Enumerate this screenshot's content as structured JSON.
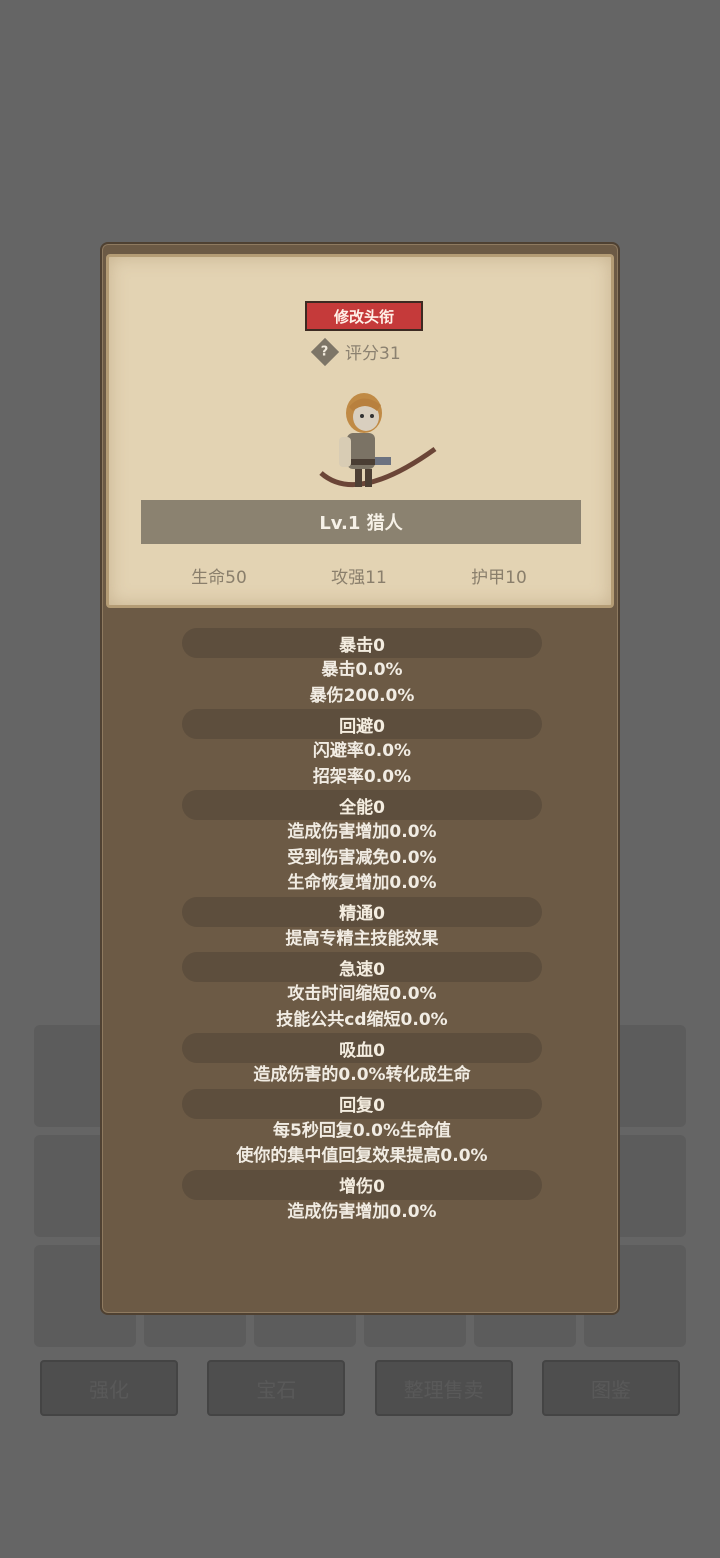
{
  "modal": {
    "title_button": "修改头衔",
    "score_label": "评分31",
    "character_name": "Lv.1 猎人",
    "stats": [
      "生命50",
      "攻强11",
      "护甲10"
    ]
  },
  "attributes": [
    {
      "header": "暴击0",
      "lines": [
        "暴击0.0%",
        "暴伤200.0%"
      ]
    },
    {
      "header": "回避0",
      "lines": [
        "闪避率0.0%",
        "招架率0.0%"
      ]
    },
    {
      "header": "全能0",
      "lines": [
        "造成伤害增加0.0%",
        "受到伤害减免0.0%",
        "生命恢复增加0.0%"
      ]
    },
    {
      "header": "精通0",
      "lines": [
        "提高专精主技能效果"
      ]
    },
    {
      "header": "急速0",
      "lines": [
        "攻击时间缩短0.0%",
        "技能公共cd缩短0.0%"
      ]
    },
    {
      "header": "吸血0",
      "lines": [
        "造成伤害的0.0%转化成生命"
      ]
    },
    {
      "header": "回复0",
      "lines": [
        "每5秒回复0.0%生命值",
        "使你的集中值回复效果提高0.0%"
      ]
    },
    {
      "header": "增伤0",
      "lines": [
        "造成伤害增加0.0%"
      ]
    }
  ],
  "background_buttons": [
    "强化",
    "宝石",
    "整理售卖",
    "图鉴"
  ]
}
